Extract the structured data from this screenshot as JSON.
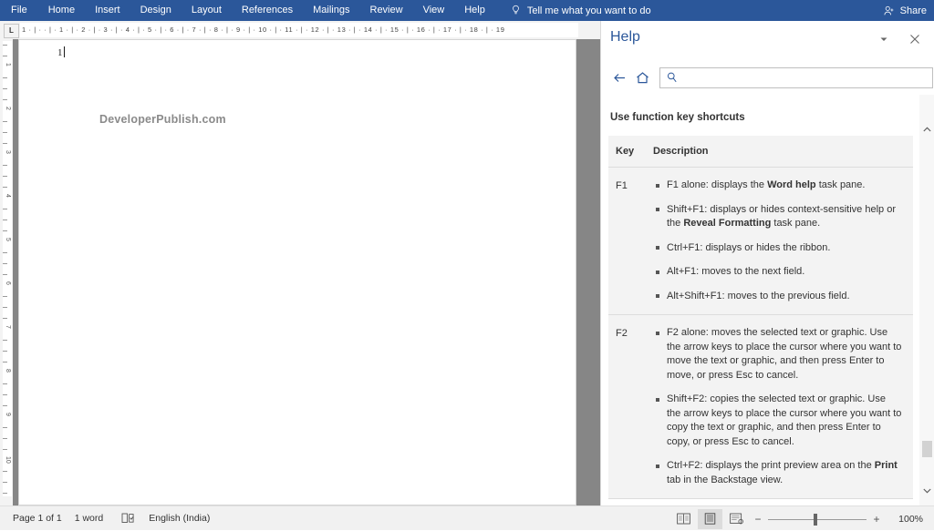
{
  "ribbon": {
    "tabs": [
      "File",
      "Home",
      "Insert",
      "Design",
      "Layout",
      "References",
      "Mailings",
      "Review",
      "View",
      "Help"
    ],
    "tellme": "Tell me what you want to do",
    "tellme_icon": "lightbulb-icon",
    "share_label": "Share",
    "share_icon": "person-add-icon",
    "accent_color": "#2b579a"
  },
  "ruler": {
    "tab_selector": "L",
    "horizontal_marks": "1  ·  |  ·      ·  |  ·  1  ·  |  ·  2  ·  |  ·  3  ·  |  ·  4  ·  |  ·  5  ·  |  ·  6  ·  |  ·  7  ·  |  ·  8  ·  |  ·  9  ·  |  ·  10  ·  |  ·  11  ·  |  ·  12  ·  |  ·  13  ·  |  ·  14  ·  |  ·  15  ·  |  ·  16  ·  |  ·  17  ·  |  ·  18  ·  |  ·  19",
    "vertical_numbers": [
      "1",
      "2",
      "3",
      "4",
      "5",
      "6",
      "7",
      "8",
      "9",
      "10"
    ]
  },
  "document": {
    "line_number": "1",
    "watermark_text": "DeveloperPublish.com"
  },
  "help": {
    "title": "Help",
    "collapse_icon": "chevron-down-icon",
    "close_icon": "close-icon",
    "back_icon": "back-arrow-icon",
    "home_icon": "home-icon",
    "search_icon": "search-icon",
    "search_value": "",
    "search_placeholder": "",
    "article_heading": "Use function key shortcuts",
    "table": {
      "headers": [
        "Key",
        "Description"
      ],
      "rows": [
        {
          "key": "F1",
          "items": [
            {
              "pre": "F1 alone: displays the ",
              "bold": "Word help",
              "post": " task pane."
            },
            {
              "pre": "Shift+F1: displays or hides context-sensitive help or the ",
              "bold": "Reveal Formatting",
              "post": " task pane."
            },
            {
              "pre": "Ctrl+F1: displays or hides the ribbon.",
              "bold": "",
              "post": ""
            },
            {
              "pre": "Alt+F1: moves to the next field.",
              "bold": "",
              "post": ""
            },
            {
              "pre": "Alt+Shift+F1: moves to the previous field.",
              "bold": "",
              "post": ""
            }
          ]
        },
        {
          "key": "F2",
          "items": [
            {
              "pre": "F2 alone: moves the selected text or graphic. Use the arrow keys to place the cursor where you want to move the text or graphic, and then press Enter to move, or press Esc to cancel.",
              "bold": "",
              "post": ""
            },
            {
              "pre": "Shift+F2: copies the selected text or graphic. Use the arrow keys to place the cursor where you want to copy the text or graphic, and then press Enter to copy, or press Esc to cancel.",
              "bold": "",
              "post": ""
            },
            {
              "pre": "Ctrl+F2: displays the print preview area on the ",
              "bold": "Print",
              "post": " tab in the Backstage view."
            }
          ]
        }
      ]
    },
    "scroll_up_icon": "scroll-up-icon",
    "scroll_down_icon": "scroll-down-icon"
  },
  "status": {
    "page": "Page 1 of 1",
    "words": "1 word",
    "proofing_icon": "proofing-errors-icon",
    "language": "English (India)",
    "views": [
      {
        "name": "read-mode",
        "label": "Read Mode",
        "active": false
      },
      {
        "name": "print-layout",
        "label": "Print Layout",
        "active": true
      },
      {
        "name": "web-layout",
        "label": "Web Layout",
        "active": false
      }
    ],
    "zoom_out_label": "−",
    "zoom_in_label": "+",
    "zoom_level": "100%"
  }
}
